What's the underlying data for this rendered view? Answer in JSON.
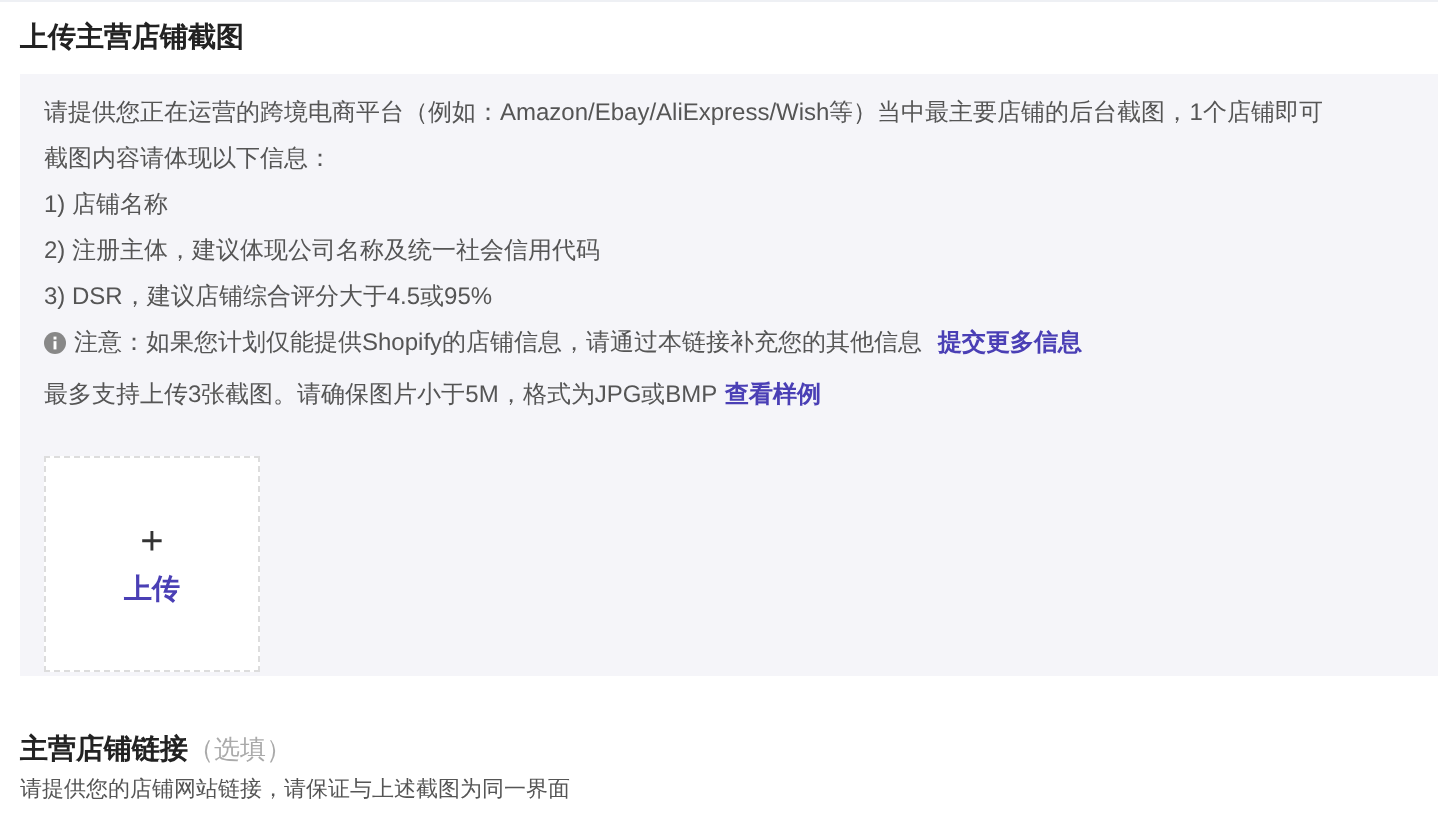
{
  "upload_section": {
    "title": "上传主营店铺截图",
    "lines": [
      "请提供您正在运营的跨境电商平台（例如：Amazon/Ebay/AliExpress/Wish等）当中最主要店铺的后台截图，1个店铺即可",
      "截图内容请体现以下信息：",
      "1) 店铺名称",
      "2) 注册主体，建议体现公司名称及统一社会信用代码",
      "3) DSR，建议店铺综合评分大于4.5或95%"
    ],
    "notice": {
      "text": "注意：如果您计划仅能提供Shopify的店铺信息，请通过本链接补充您的其他信息",
      "link": "提交更多信息"
    },
    "limit": {
      "text": "最多支持上传3张截图。请确保图片小于5M，格式为JPG或BMP",
      "link": "查看样例"
    },
    "upload_button": {
      "icon": "+",
      "label": "上传"
    }
  },
  "link_section": {
    "title": "主营店铺链接",
    "optional": "（选填）",
    "description": "请提供您的店铺网站链接，请保证与上述截图为同一界面"
  }
}
